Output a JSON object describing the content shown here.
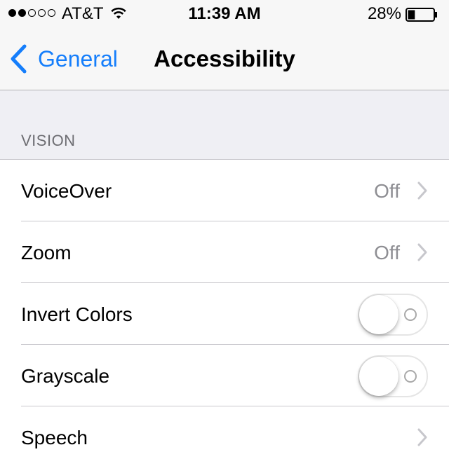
{
  "status_bar": {
    "signal_bars_filled": 2,
    "signal_bars_total": 5,
    "carrier": "AT&T",
    "wifi_icon": "wifi-icon",
    "time": "11:39 AM",
    "battery_percent": "28%",
    "battery_level": 0.28
  },
  "nav": {
    "back_label": "General",
    "back_icon": "chevron-left-icon",
    "title": "Accessibility",
    "accent_color": "#157efb"
  },
  "section": {
    "header": "VISION"
  },
  "rows": [
    {
      "label": "VoiceOver",
      "value": "Off",
      "accessory": "chevron"
    },
    {
      "label": "Zoom",
      "value": "Off",
      "accessory": "chevron"
    },
    {
      "label": "Invert Colors",
      "accessory": "toggle",
      "on": false
    },
    {
      "label": "Grayscale",
      "accessory": "toggle",
      "on": false
    },
    {
      "label": "Speech",
      "accessory": "chevron"
    }
  ]
}
